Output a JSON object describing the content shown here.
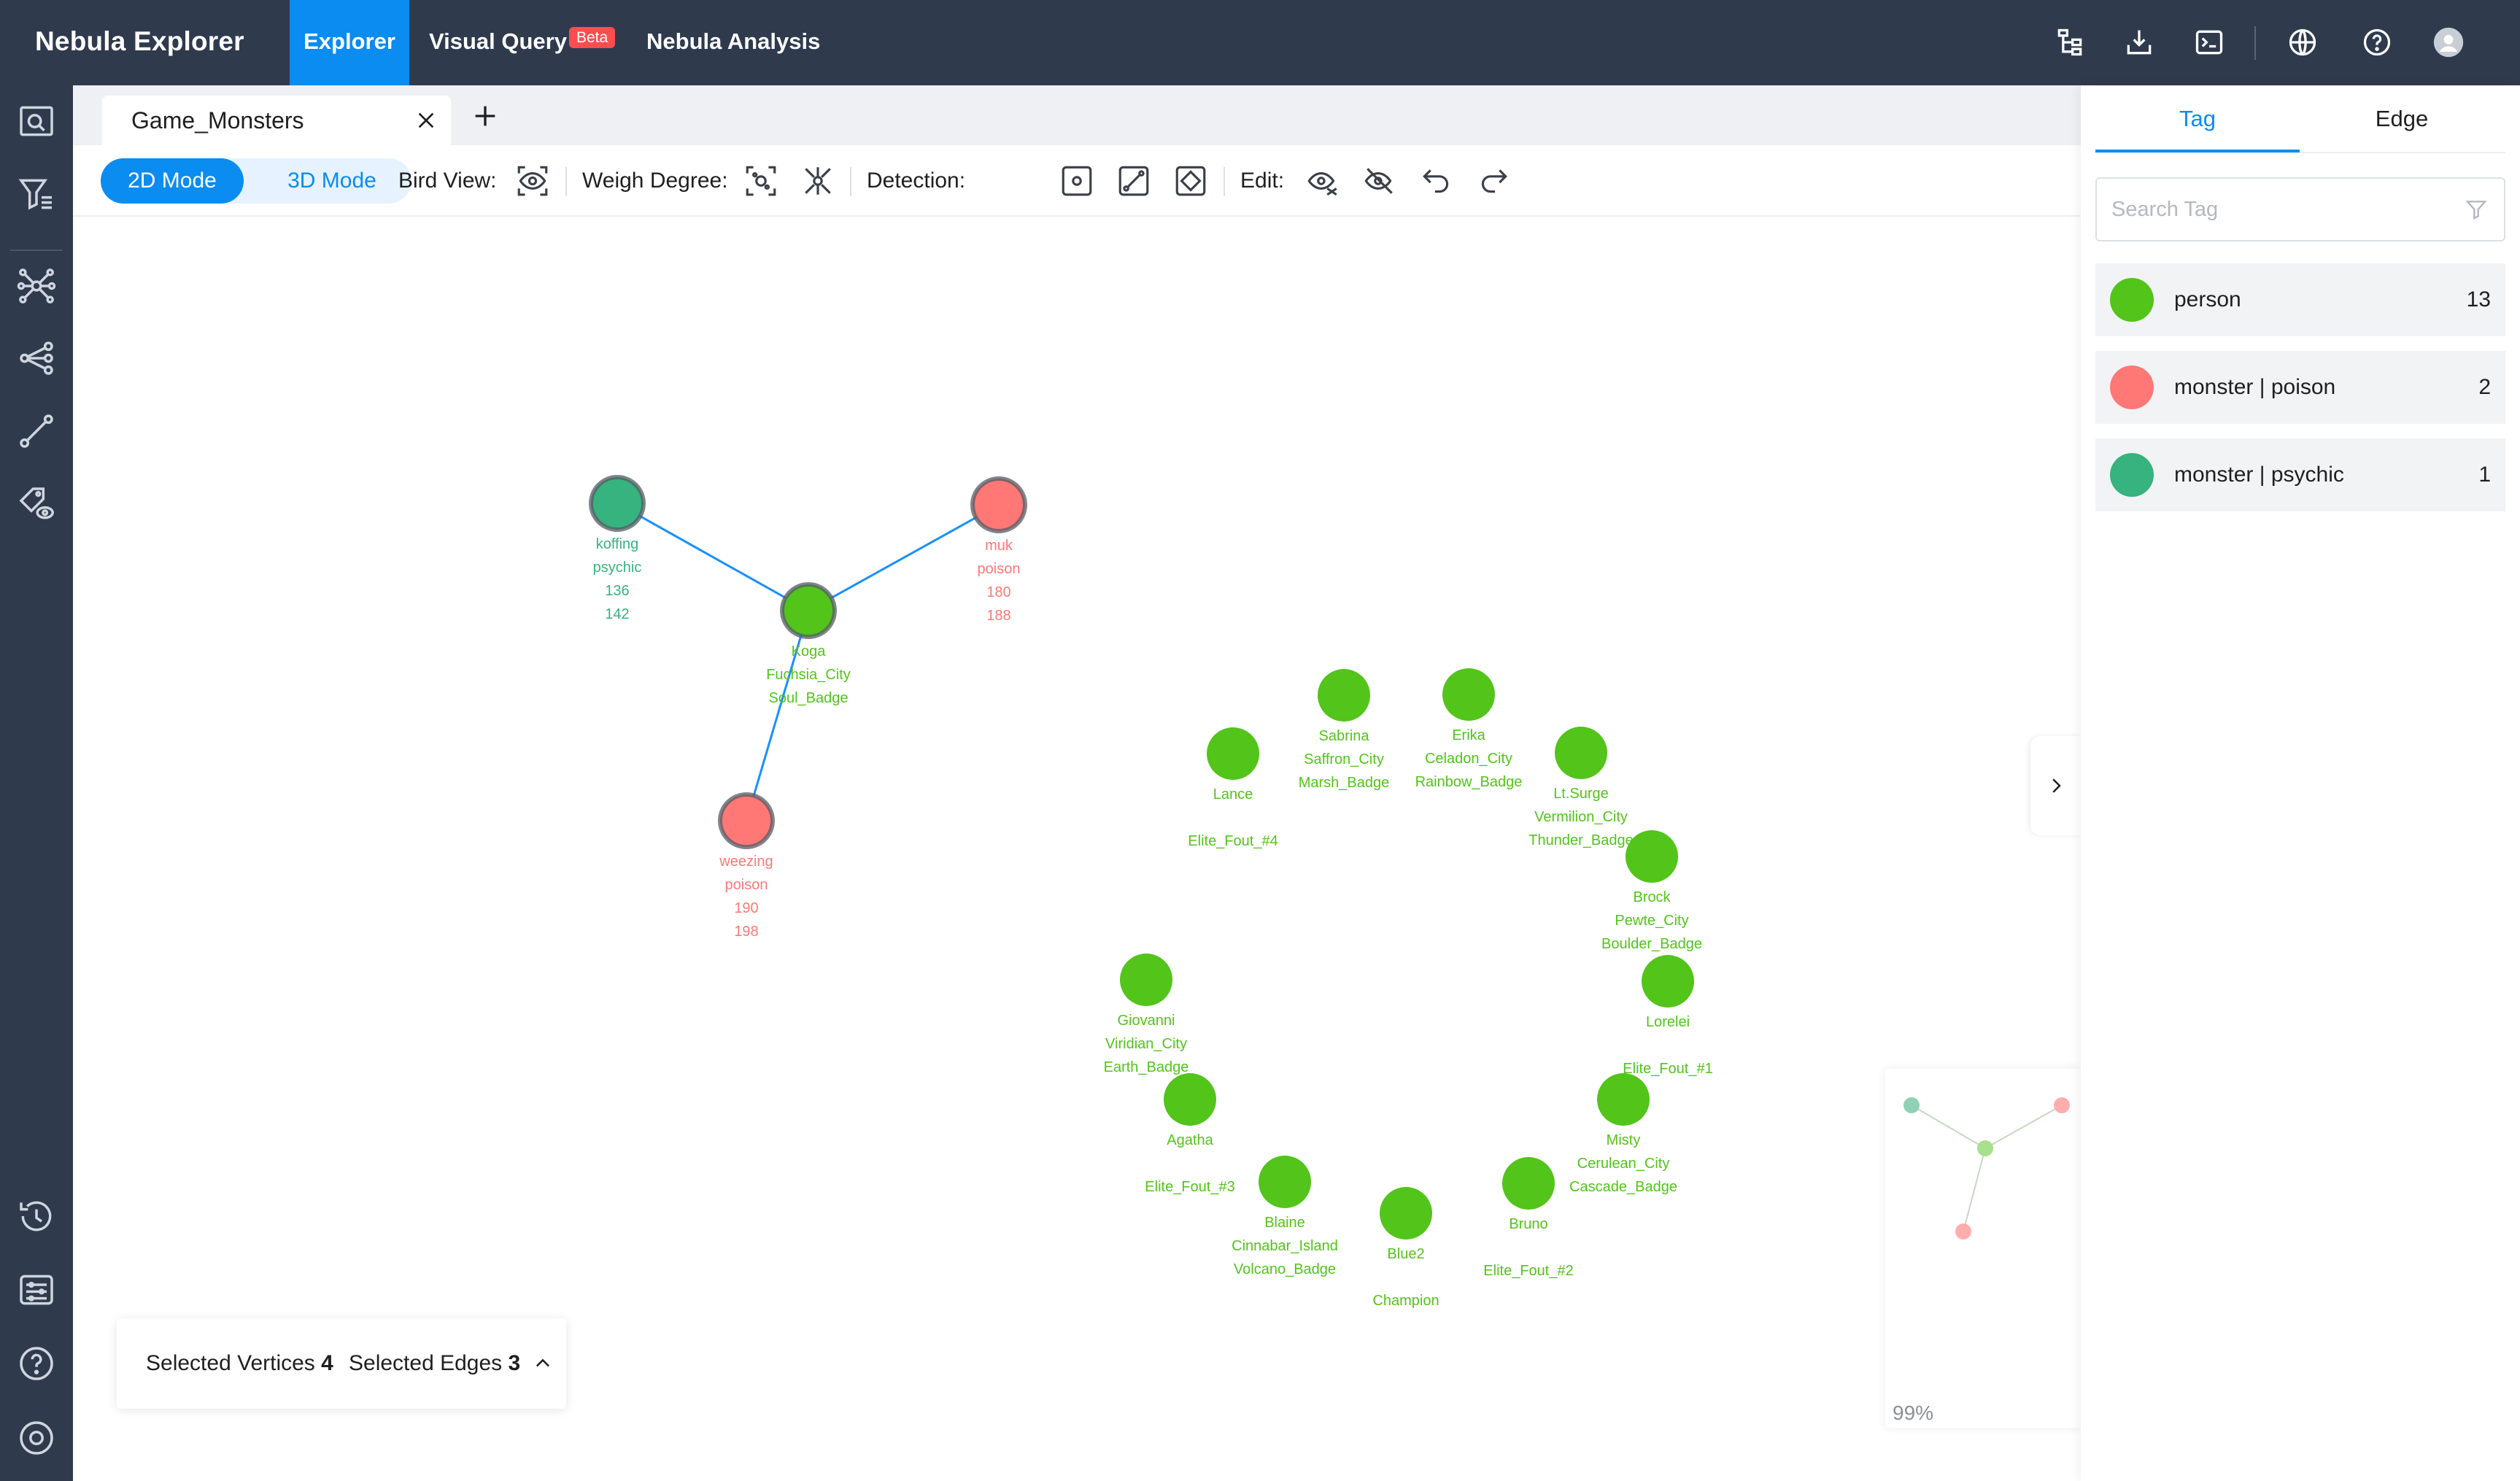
{
  "app": {
    "title": "Nebula Explorer"
  },
  "nav": {
    "explorer": "Explorer",
    "visual_query": "Visual Query",
    "beta": "Beta",
    "analysis": "Nebula Analysis"
  },
  "colors": {
    "topbar": "#2f3a4d",
    "accent": "#0a8cf0",
    "person": "#52c41a",
    "monster_poison": "#ff7875",
    "monster_psychic": "#36b37e",
    "edge": "#1890ff"
  },
  "tab": {
    "title": "Game_Monsters"
  },
  "toolbar": {
    "mode_2d": "2D Mode",
    "mode_3d": "3D Mode",
    "bird_view": "Bird View:",
    "weigh_degree": "Weigh Degree:",
    "detection": "Detection:",
    "edit": "Edit:"
  },
  "graph": {
    "vertices": [
      {
        "id": "koffing",
        "kind": "psychic",
        "lines": [
          "koffing",
          "psychic",
          "136",
          "142"
        ],
        "selected": true
      },
      {
        "id": "muk",
        "kind": "poison",
        "lines": [
          "muk",
          "poison",
          "180",
          "188"
        ],
        "selected": true
      },
      {
        "id": "koga",
        "kind": "person",
        "lines": [
          "Koga",
          "Fuchsia_City",
          "Soul_Badge"
        ],
        "selected": true
      },
      {
        "id": "weezing",
        "kind": "poison",
        "lines": [
          "weezing",
          "poison",
          "190",
          "198"
        ],
        "selected": true
      },
      {
        "id": "sabrina",
        "kind": "person",
        "lines": [
          "Sabrina",
          "Saffron_City",
          "Marsh_Badge"
        ]
      },
      {
        "id": "erika",
        "kind": "person",
        "lines": [
          "Erika",
          "Celadon_City",
          "Rainbow_Badge"
        ]
      },
      {
        "id": "lance",
        "kind": "person",
        "lines": [
          "Lance",
          "",
          "Elite_Fout_#4"
        ]
      },
      {
        "id": "ltsurge",
        "kind": "person",
        "lines": [
          "Lt.Surge",
          "Vermilion_City",
          "Thunder_Badge"
        ]
      },
      {
        "id": "brock",
        "kind": "person",
        "lines": [
          "Brock",
          "Pewte_City",
          "Boulder_Badge"
        ]
      },
      {
        "id": "lorelei",
        "kind": "person",
        "lines": [
          "Lorelei",
          "",
          "Elite_Fout_#1"
        ]
      },
      {
        "id": "giovanni",
        "kind": "person",
        "lines": [
          "Giovanni",
          "Viridian_City",
          "Earth_Badge"
        ]
      },
      {
        "id": "agatha",
        "kind": "person",
        "lines": [
          "Agatha",
          "",
          "Elite_Fout_#3"
        ]
      },
      {
        "id": "misty",
        "kind": "person",
        "lines": [
          "Misty",
          "Cerulean_City",
          "Cascade_Badge"
        ]
      },
      {
        "id": "blaine",
        "kind": "person",
        "lines": [
          "Blaine",
          "Cinnabar_Island",
          "Volcano_Badge"
        ]
      },
      {
        "id": "blue2",
        "kind": "person",
        "lines": [
          "Blue2",
          "",
          "Champion"
        ]
      },
      {
        "id": "bruno",
        "kind": "person",
        "lines": [
          "Bruno",
          "",
          "Elite_Fout_#2"
        ]
      }
    ],
    "edges": [
      {
        "from": "koga",
        "to": "koffing"
      },
      {
        "from": "koga",
        "to": "muk"
      },
      {
        "from": "koga",
        "to": "weezing"
      }
    ]
  },
  "minimap": {
    "zoom": "99%"
  },
  "selection": {
    "vertices_label": "Selected Vertices",
    "vertices_count": "4",
    "edges_label": "Selected Edges",
    "edges_count": "3"
  },
  "right_panel": {
    "tabs": {
      "tag": "Tag",
      "edge": "Edge"
    },
    "search_placeholder": "Search Tag",
    "tags": [
      {
        "name": "person",
        "count": "13",
        "color": "#52c41a"
      },
      {
        "name": "monster | poison",
        "count": "2",
        "color": "#ff7875"
      },
      {
        "name": "monster | psychic",
        "count": "1",
        "color": "#36b37e"
      }
    ]
  }
}
